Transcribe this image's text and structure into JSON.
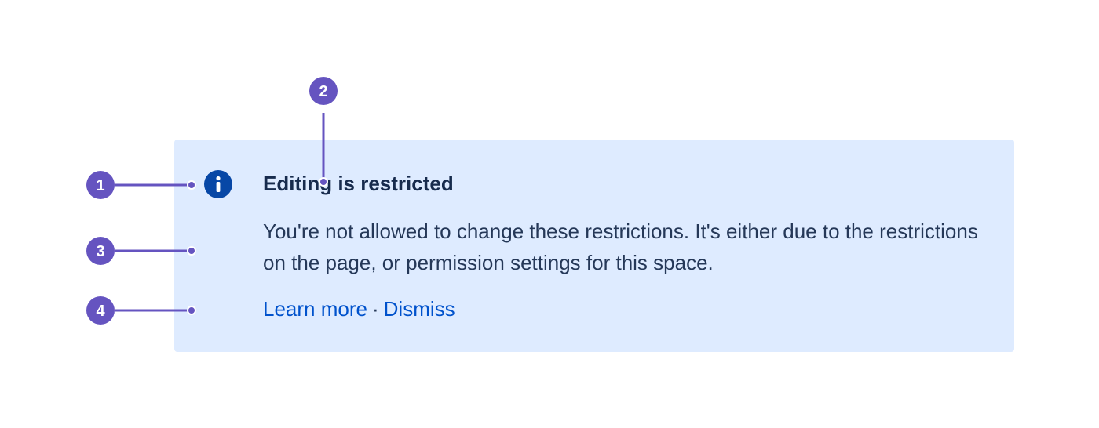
{
  "flag": {
    "icon": "info-icon",
    "title": "Editing is restricted",
    "description": "You're not allowed to change these restrictions. It's either due to the restrictions on the page, or permission settings for this space.",
    "actions": {
      "learn_more": "Learn more",
      "separator": "·",
      "dismiss": "Dismiss"
    },
    "background_color": "#deebff",
    "icon_color": "#0747a6",
    "link_color": "#0052cc"
  },
  "annotations": {
    "color": "#6554c0",
    "markers": [
      {
        "number": "1",
        "target": "icon"
      },
      {
        "number": "2",
        "target": "title"
      },
      {
        "number": "3",
        "target": "description"
      },
      {
        "number": "4",
        "target": "actions"
      }
    ]
  }
}
